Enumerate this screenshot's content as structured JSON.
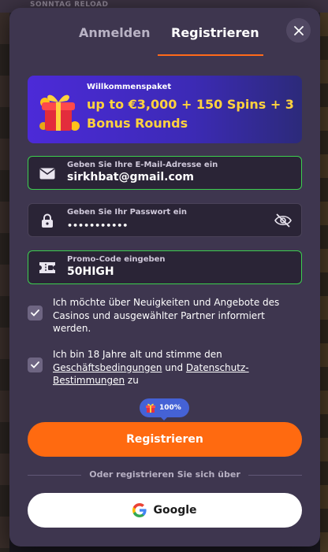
{
  "background": {
    "banner_text": "SONNTAG RELOAD"
  },
  "tabs": {
    "login_label": "Anmelden",
    "register_label": "Registrieren",
    "active": "register"
  },
  "promo_banner": {
    "title": "Willkommenspaket",
    "offer": "up to €3,000 + 150 Spins + 3 Bonus Rounds",
    "gift_icon": "gift-box-icon"
  },
  "form": {
    "email": {
      "label": "Geben Sie Ihre E-Mail-Adresse ein",
      "value": "sirkhbat@gmail.com",
      "icon": "envelope-icon"
    },
    "password": {
      "label": "Geben Sie Ihr Passwort ein",
      "value": "•••••••••••",
      "icon": "lock-icon",
      "toggle_icon": "eye-slash-icon"
    },
    "promo_code": {
      "label": "Promo-Code eingeben",
      "value": "50HIGH",
      "icon": "ticket-icon"
    }
  },
  "consents": {
    "newsletter": {
      "checked": true,
      "text": "Ich möchte über Neuigkeiten und Angebote des Casinos und ausgewählter Partner informiert werden."
    },
    "terms": {
      "checked": true,
      "prefix": "Ich bin 18 Jahre alt und stimme den ",
      "terms_link": "Geschäftsbedingungen",
      "middle": " und ",
      "privacy_link": "Datenschutz-Bestimmungen",
      "suffix": " zu"
    }
  },
  "bonus_pill": {
    "text": "100%",
    "icon": "gift-icon"
  },
  "actions": {
    "register_button": "Registrieren",
    "divider_text": "Oder registrieren Sie sich über",
    "google_button": "Google"
  },
  "colors": {
    "modal_bg": "#3e364f",
    "accent_orange": "#ff6a10",
    "valid_green": "#3ccf4e",
    "banner_yellow": "#ffd23d",
    "pill_blue": "#4562d6"
  }
}
